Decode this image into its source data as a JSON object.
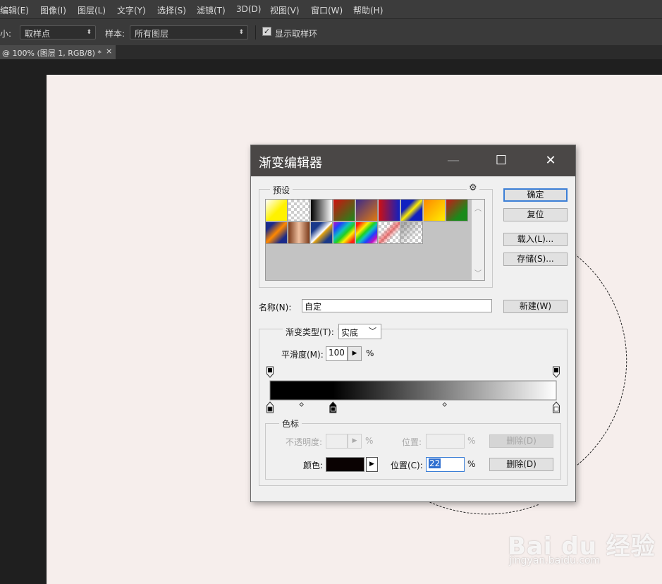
{
  "menu": [
    "编辑(E)",
    "图像(I)",
    "图层(L)",
    "文字(Y)",
    "选择(S)",
    "滤镜(T)",
    "3D(D)",
    "视图(V)",
    "窗口(W)",
    "帮助(H)"
  ],
  "options": {
    "size_label": "大小:",
    "size_value": "取样点",
    "sample_label": "样本:",
    "sample_value": "所有图层",
    "show_ring_label": "显示取样环",
    "show_ring_checked": true
  },
  "doc_tab": {
    "title": "@ 100% (图层 1, RGB/8) *",
    "close": "×"
  },
  "dialog": {
    "title": "渐变编辑器",
    "minimize": "—",
    "maximize": "☐",
    "close": "✕",
    "presets_label": "预设",
    "presets_gear": "⚙",
    "buttons": {
      "ok": "确定",
      "reset": "复位",
      "load": "载入(L)...",
      "save": "存储(S)...",
      "new": "新建(W)"
    },
    "name_label": "名称(N):",
    "name_value": "自定",
    "gradient_type_label": "渐变类型(T):",
    "gradient_type_value": "实底",
    "smoothness_label": "平滑度(M):",
    "smoothness_value": "100",
    "smoothness_unit": "%",
    "stops_group_label": "色标",
    "opacity_label": "不透明度:",
    "opacity_unit": "%",
    "opacity_location_label": "位置:",
    "opacity_location_unit": "%",
    "opacity_delete": "删除(D)",
    "color_label": "颜色:",
    "color_swatch": "#0a0202",
    "color_location_label": "位置(C):",
    "color_location_value": "22",
    "color_location_unit": "%",
    "color_delete": "删除(D)"
  },
  "preset_swatches": [
    "linear-gradient(135deg,#ffffff,#fff200 55%)",
    "checker",
    "linear-gradient(90deg,#000,#fff)",
    "linear-gradient(135deg,#d01010,#1a8a1a)",
    "linear-gradient(135deg,#3a2a8a,#e07a10)",
    "linear-gradient(90deg,#d01010,#1020c0)",
    "linear-gradient(135deg,#1020c0 30%,#ffee00 50%,#1020c0 70%)",
    "linear-gradient(135deg,#ff8800,#ffee00)",
    "linear-gradient(135deg,#c81818,#1a8a1a 70%)",
    "linear-gradient(135deg,#1a2a8a 20%,#ff8800 50%,#1a2a8a 80%)",
    "linear-gradient(90deg,#7a3a1a,#f0c0a0 50%,#7a3a1a)",
    "linear-gradient(135deg,#1a3a8a 25%,#ffffff 50%,#e0a010 55%,#1a3a8a 80%)",
    "linear-gradient(135deg,#c010c0 0%,#2040ff 20%,#10c0c0 40%,#20d020 55%,#ffee00 70%,#ff2010 90%)",
    "linear-gradient(135deg,#ff2010 10%,#ffee00 30%,#20d020 45%,#10c0c0 55%,#2040ff 70%,#c010c0 85%,#ffffff)",
    "checker-red",
    "checker-gray"
  ],
  "gradient_bar": {
    "stops": [
      {
        "location": 0,
        "color": "#000000"
      },
      {
        "location": 22,
        "color": "#000000"
      },
      {
        "location": 100,
        "color": "#ffffff"
      }
    ],
    "selected_stop_location": 22
  },
  "watermark": {
    "text": "Bai du 经验",
    "url": "jingyan.baidu.com"
  }
}
